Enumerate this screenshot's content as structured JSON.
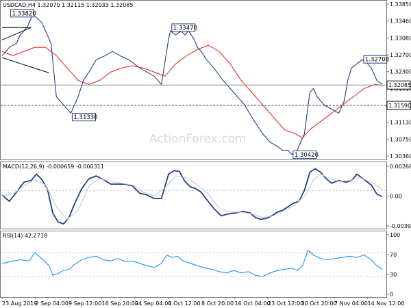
{
  "chart_data": [
    {
      "panel": "price",
      "type": "line",
      "title": "USDCAD,H4  1.32070 1.32115 1.32033 1.32085",
      "ylim": [
        1.3036,
        1.3405
      ],
      "y_ticks": [
        "1.33850",
        "1.33460",
        "1.33080",
        "1.32700",
        "1.32300",
        "1.31910",
        "1.31520",
        "1.31130",
        "1.30750",
        "1.30360"
      ],
      "current_price_label": "1.32085",
      "current_price": 1.32085,
      "support_label": "1.31590",
      "support_level": 1.3159,
      "annotations": [
        {
          "text": "1.33820",
          "x": 4,
          "y": 1.3382
        },
        {
          "text": "1.31330",
          "x": 38,
          "y": 1.3133
        },
        {
          "text": "1.33470",
          "x": 93,
          "y": 1.3347
        },
        {
          "text": "1.30420",
          "x": 160,
          "y": 1.3042
        },
        {
          "text": "1.32700",
          "x": 199,
          "y": 1.327
        }
      ],
      "x_labels": [
        "23 Aug 2019",
        "2 Sep 04:00",
        "9 Sep 12:00",
        "16 Sep 20:00",
        "24 Sep 04:00",
        "1 Oct 12:00",
        "8 Oct 20:00",
        "16 Oct 04:00",
        "23 Oct 12:00",
        "30 Oct 20:00",
        "7 Nov 04:00",
        "14 Nov 12:00"
      ],
      "series": [
        {
          "color": "#1f3f87",
          "x": [
            0,
            4,
            8,
            10,
            14,
            17,
            22,
            27,
            30,
            34,
            38,
            42,
            45,
            48,
            52,
            57,
            61,
            65,
            70,
            76,
            80,
            84,
            88,
            92,
            93,
            96,
            99,
            101,
            103,
            106,
            108,
            110,
            113,
            117,
            122,
            126,
            130,
            134,
            138,
            141,
            144,
            148,
            152,
            155,
            158,
            160,
            163,
            165,
            167,
            170,
            172,
            174,
            178,
            182,
            186,
            189,
            191,
            193,
            196,
            199,
            202,
            204,
            207,
            210
          ],
          "values": [
            1.328,
            1.33,
            1.331,
            1.333,
            1.335,
            1.338,
            1.336,
            1.331,
            1.318,
            1.316,
            1.314,
            1.318,
            1.322,
            1.324,
            1.327,
            1.328,
            1.329,
            1.328,
            1.327,
            1.325,
            1.324,
            1.323,
            1.321,
            1.332,
            1.334,
            1.333,
            1.334,
            1.333,
            1.334,
            1.332,
            1.33,
            1.329,
            1.327,
            1.325,
            1.322,
            1.32,
            1.318,
            1.316,
            1.313,
            1.311,
            1.309,
            1.307,
            1.306,
            1.305,
            1.305,
            1.304,
            1.305,
            1.307,
            1.309,
            1.319,
            1.32,
            1.318,
            1.316,
            1.315,
            1.314,
            1.317,
            1.322,
            1.325,
            1.326,
            1.327,
            1.326,
            1.325,
            1.322,
            1.321
          ]
        },
        {
          "color": "#e8302a",
          "x": [
            0,
            6,
            12,
            18,
            24,
            30,
            36,
            42,
            48,
            54,
            60,
            66,
            72,
            78,
            84,
            90,
            96,
            102,
            108,
            114,
            120,
            126,
            132,
            138,
            144,
            150,
            156,
            162,
            166,
            170,
            176,
            182,
            188,
            194,
            200,
            206,
            210
          ],
          "values": [
            1.329,
            1.328,
            1.329,
            1.33,
            1.33,
            1.328,
            1.325,
            1.322,
            1.321,
            1.322,
            1.324,
            1.325,
            1.3255,
            1.325,
            1.324,
            1.323,
            1.326,
            1.328,
            1.3295,
            1.3305,
            1.329,
            1.326,
            1.322,
            1.319,
            1.316,
            1.313,
            1.31,
            1.309,
            1.308,
            1.31,
            1.312,
            1.314,
            1.316,
            1.318,
            1.32,
            1.321,
            1.3208
          ]
        }
      ]
    },
    {
      "panel": "macd",
      "type": "line",
      "title": "MACD(12,26,9) -0.000659 -0.000311",
      "ylim": [
        -0.003922,
        0.002667
      ],
      "y_ticks": [
        "0.002667",
        "0.00",
        "-0.003922"
      ],
      "series": [
        {
          "color": "#1f3f87",
          "x": [
            0,
            4,
            8,
            12,
            16,
            19,
            22,
            25,
            28,
            31,
            34,
            37,
            40,
            44,
            48,
            52,
            56,
            60,
            64,
            68,
            72,
            76,
            80,
            84,
            88,
            92,
            95,
            98,
            101,
            104,
            107,
            110,
            113,
            117,
            121,
            125,
            129,
            133,
            137,
            140,
            143,
            146,
            149,
            152,
            155,
            158,
            161,
            164,
            167,
            170,
            173,
            176,
            179,
            182,
            186,
            190,
            193,
            196,
            200,
            204,
            207,
            210
          ],
          "values": [
            -0.0005,
            -0.0012,
            -0.0002,
            0.0009,
            0.0011,
            0.0018,
            0.0012,
            0.0002,
            -0.0025,
            -0.0035,
            -0.0037,
            -0.003,
            -0.0015,
            0.0002,
            0.0013,
            0.0016,
            0.0012,
            0.0007,
            0.0007,
            0.0007,
            0.0005,
            -0.0003,
            -0.0005,
            -0.0009,
            -0.0009,
            0.0018,
            0.0022,
            0.0021,
            0.001,
            0.0004,
            0.0002,
            -0.0002,
            -0.001,
            -0.002,
            -0.0028,
            -0.0026,
            -0.0025,
            -0.0023,
            -0.0025,
            -0.003,
            -0.0032,
            -0.0031,
            -0.0028,
            -0.0024,
            -0.0022,
            -0.0018,
            -0.0014,
            -0.0012,
            0.0,
            0.002,
            0.0024,
            0.002,
            0.0013,
            0.0008,
            0.0011,
            0.0009,
            0.0011,
            0.0018,
            0.0012,
            0.0006,
            -0.0004,
            -0.0007
          ]
        },
        {
          "color": "#c8c8c8",
          "x": [
            0,
            6,
            12,
            18,
            24,
            30,
            36,
            42,
            48,
            54,
            60,
            66,
            72,
            78,
            84,
            90,
            96,
            102,
            108,
            114,
            120,
            126,
            132,
            138,
            144,
            150,
            156,
            162,
            168,
            172,
            176,
            180,
            186,
            192,
            198,
            204,
            210
          ],
          "values": [
            -0.0006,
            -0.0004,
            0.0005,
            0.0012,
            0.0006,
            -0.0018,
            -0.0032,
            -0.0022,
            0.0005,
            0.0013,
            0.001,
            0.0008,
            0.0006,
            -0.0002,
            -0.0006,
            0.0003,
            0.0016,
            0.0014,
            0.0006,
            -0.0004,
            -0.002,
            -0.0024,
            -0.0024,
            -0.0026,
            -0.003,
            -0.0028,
            -0.0022,
            -0.0016,
            -0.0004,
            0.0012,
            0.0018,
            0.0014,
            0.001,
            0.0011,
            0.0014,
            0.0009,
            0.0001
          ]
        }
      ]
    },
    {
      "panel": "rsi",
      "type": "line",
      "title": "RSI(14) 42.2718",
      "ylim": [
        0,
        100
      ],
      "y_ticks": [
        "100",
        "70",
        "30",
        "0"
      ],
      "levels": [
        70,
        30
      ],
      "series": [
        {
          "color": "#1e90ff",
          "x": [
            0,
            5,
            10,
            15,
            18,
            22,
            26,
            28,
            31,
            34,
            37,
            40,
            44,
            48,
            52,
            56,
            60,
            64,
            68,
            72,
            76,
            80,
            84,
            88,
            91,
            94,
            97,
            100,
            104,
            108,
            112,
            116,
            120,
            124,
            128,
            132,
            136,
            140,
            144,
            148,
            152,
            156,
            160,
            163,
            166,
            169,
            172,
            176,
            180,
            184,
            188,
            192,
            196,
            200,
            204,
            207,
            210
          ],
          "values": [
            52,
            55,
            58,
            56,
            70,
            60,
            48,
            32,
            35,
            40,
            42,
            50,
            58,
            62,
            64,
            58,
            56,
            60,
            55,
            56,
            52,
            48,
            45,
            52,
            66,
            62,
            64,
            56,
            52,
            48,
            44,
            42,
            38,
            36,
            40,
            36,
            38,
            32,
            30,
            36,
            40,
            42,
            44,
            40,
            48,
            74,
            66,
            60,
            58,
            60,
            62,
            64,
            62,
            66,
            58,
            48,
            42
          ]
        }
      ]
    }
  ],
  "watermark": "ActionForex.com"
}
